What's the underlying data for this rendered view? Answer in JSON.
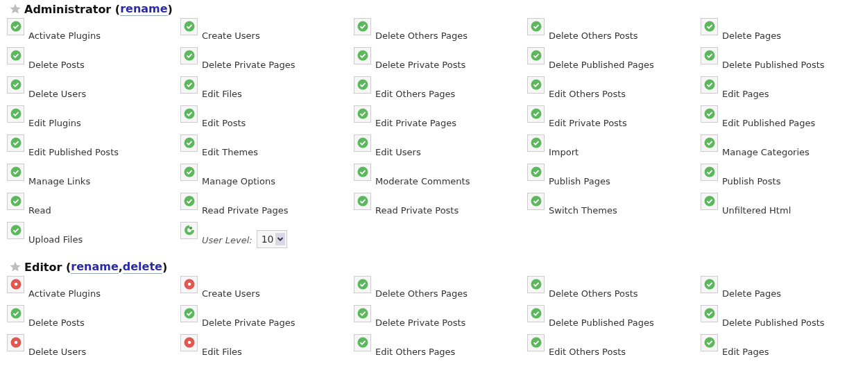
{
  "roles": [
    {
      "heading": [
        {
          "kind": "text",
          "text": "Administrator ("
        },
        {
          "kind": "link",
          "text": "rename"
        },
        {
          "kind": "text",
          "text": ")"
        }
      ],
      "items": [
        {
          "kind": "capability",
          "label": "Activate Plugins",
          "granted": true
        },
        {
          "kind": "capability",
          "label": "Create Users",
          "granted": true
        },
        {
          "kind": "capability",
          "label": "Delete Others Pages",
          "granted": true
        },
        {
          "kind": "capability",
          "label": "Delete Others Posts",
          "granted": true
        },
        {
          "kind": "capability",
          "label": "Delete Pages",
          "granted": true
        },
        {
          "kind": "capability",
          "label": "Delete Posts",
          "granted": true
        },
        {
          "kind": "capability",
          "label": "Delete Private Pages",
          "granted": true
        },
        {
          "kind": "capability",
          "label": "Delete Private Posts",
          "granted": true
        },
        {
          "kind": "capability",
          "label": "Delete Published Pages",
          "granted": true
        },
        {
          "kind": "capability",
          "label": "Delete Published Posts",
          "granted": true
        },
        {
          "kind": "capability",
          "label": "Delete Users",
          "granted": true
        },
        {
          "kind": "capability",
          "label": "Edit Files",
          "granted": true
        },
        {
          "kind": "capability",
          "label": "Edit Others Pages",
          "granted": true
        },
        {
          "kind": "capability",
          "label": "Edit Others Posts",
          "granted": true
        },
        {
          "kind": "capability",
          "label": "Edit Pages",
          "granted": true
        },
        {
          "kind": "capability",
          "label": "Edit Plugins",
          "granted": true
        },
        {
          "kind": "capability",
          "label": "Edit Posts",
          "granted": true
        },
        {
          "kind": "capability",
          "label": "Edit Private Pages",
          "granted": true
        },
        {
          "kind": "capability",
          "label": "Edit Private Posts",
          "granted": true
        },
        {
          "kind": "capability",
          "label": "Edit Published Pages",
          "granted": true
        },
        {
          "kind": "capability",
          "label": "Edit Published Posts",
          "granted": true
        },
        {
          "kind": "capability",
          "label": "Edit Themes",
          "granted": true
        },
        {
          "kind": "capability",
          "label": "Edit Users",
          "granted": true
        },
        {
          "kind": "capability",
          "label": "Import",
          "granted": true
        },
        {
          "kind": "capability",
          "label": "Manage Categories",
          "granted": true
        },
        {
          "kind": "capability",
          "label": "Manage Links",
          "granted": true
        },
        {
          "kind": "capability",
          "label": "Manage Options",
          "granted": true
        },
        {
          "kind": "capability",
          "label": "Moderate Comments",
          "granted": true
        },
        {
          "kind": "capability",
          "label": "Publish Pages",
          "granted": true
        },
        {
          "kind": "capability",
          "label": "Publish Posts",
          "granted": true
        },
        {
          "kind": "capability",
          "label": "Read",
          "granted": true
        },
        {
          "kind": "capability",
          "label": "Read Private Pages",
          "granted": true
        },
        {
          "kind": "capability",
          "label": "Read Private Posts",
          "granted": true
        },
        {
          "kind": "capability",
          "label": "Switch Themes",
          "granted": true
        },
        {
          "kind": "capability",
          "label": "Unfiltered Html",
          "granted": true
        },
        {
          "kind": "capability",
          "label": "Upload Files",
          "granted": true
        },
        {
          "kind": "level",
          "label": "User Level:",
          "value": "10"
        }
      ]
    },
    {
      "heading": [
        {
          "kind": "text",
          "text": "Editor ("
        },
        {
          "kind": "link",
          "text": "rename"
        },
        {
          "kind": "text",
          "text": ","
        },
        {
          "kind": "link",
          "text": "delete"
        },
        {
          "kind": "text",
          "text": ")"
        }
      ],
      "items": [
        {
          "kind": "capability",
          "label": "Activate Plugins",
          "granted": false
        },
        {
          "kind": "capability",
          "label": "Create Users",
          "granted": false
        },
        {
          "kind": "capability",
          "label": "Delete Others Pages",
          "granted": true
        },
        {
          "kind": "capability",
          "label": "Delete Others Posts",
          "granted": true
        },
        {
          "kind": "capability",
          "label": "Delete Pages",
          "granted": true
        },
        {
          "kind": "capability",
          "label": "Delete Posts",
          "granted": true
        },
        {
          "kind": "capability",
          "label": "Delete Private Pages",
          "granted": true
        },
        {
          "kind": "capability",
          "label": "Delete Private Posts",
          "granted": true
        },
        {
          "kind": "capability",
          "label": "Delete Published Pages",
          "granted": true
        },
        {
          "kind": "capability",
          "label": "Delete Published Posts",
          "granted": true
        },
        {
          "kind": "capability",
          "label": "Delete Users",
          "granted": false
        },
        {
          "kind": "capability",
          "label": "Edit Files",
          "granted": false
        },
        {
          "kind": "capability",
          "label": "Edit Others Pages",
          "granted": true
        },
        {
          "kind": "capability",
          "label": "Edit Others Posts",
          "granted": true
        },
        {
          "kind": "capability",
          "label": "Edit Pages",
          "granted": true
        }
      ]
    }
  ]
}
